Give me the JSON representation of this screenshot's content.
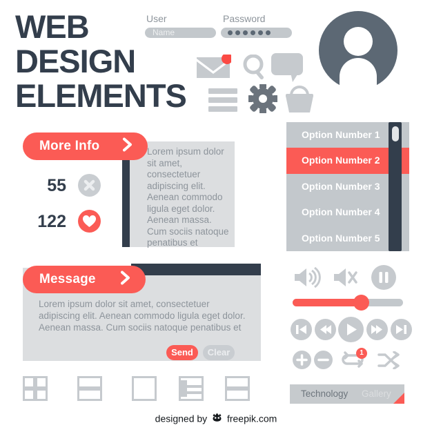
{
  "title": {
    "line1": "WEB",
    "line2": "DESIGN",
    "line3": "ELEMENTS"
  },
  "form": {
    "user_label": "User",
    "user_placeholder": "Name",
    "user_value": "",
    "password_label": "Password",
    "password_value": "••••••",
    "password_dot_count": 6
  },
  "icons": {
    "row1": [
      "envelope-icon",
      "search-icon",
      "chat-bubble-icon"
    ],
    "row2": [
      "hamburger-menu-icon",
      "gear-icon",
      "basket-icon"
    ],
    "avatar": "user-avatar-icon",
    "envelope_badge": true
  },
  "options": {
    "items": [
      {
        "label": "Option Number 1",
        "active": false
      },
      {
        "label": "Option Number 2",
        "active": true
      },
      {
        "label": "Option Number 3",
        "active": false
      },
      {
        "label": "Option Number 4",
        "active": false
      },
      {
        "label": "Option Number 5",
        "active": false
      }
    ]
  },
  "info_card": {
    "button_label": "More Info",
    "body_text": "Lorem ipsum dolor sit amet, consectetuer adipiscing elit. Aenean commodo ligula eget dolor. Aenean massa. Cum sociis natoque penatibus et",
    "counters": [
      {
        "value": "55",
        "icon": "close-icon",
        "color": "#c9cdd1"
      },
      {
        "value": "122",
        "icon": "heart-icon",
        "color": "#fb5b55"
      }
    ]
  },
  "message_card": {
    "button_label": "Message",
    "body_text": "Lorem ipsum dolor sit amet, consectetuer adipiscing elit. Aenean commodo ligula eget dolor. Aenean massa. Cum sociis natoque penatibus et",
    "send_label": "Send",
    "clear_label": "Clear"
  },
  "layout_icons": [
    "grid-four-layout-icon",
    "two-row-layout-icon",
    "single-block-layout-icon",
    "list-layout-icon",
    "split-layout-icon"
  ],
  "media": {
    "volume_on_icon": "volume-on-icon",
    "volume_mute_icon": "volume-mute-icon",
    "pause_icon": "pause-icon",
    "volume_percent": 62,
    "transport": [
      "skip-to-start-icon",
      "rewind-icon",
      "play-icon",
      "fast-forward-icon",
      "skip-to-end-icon"
    ],
    "extra": [
      "plus-icon",
      "minus-icon",
      "repeat-icon",
      "shuffle-icon"
    ],
    "repeat_badge": "1"
  },
  "tabs": {
    "items": [
      {
        "label": "Technology",
        "selected": true
      },
      {
        "label": "Gallery",
        "selected": false
      }
    ]
  },
  "footer": {
    "prefix": "designed by",
    "brand": "freepik.com"
  },
  "colors": {
    "accent_red": "#fb5b55",
    "dark_navy": "#333e4c",
    "mid_gray": "#c3c8cc",
    "light_gray": "#dcdee0",
    "text_gray": "#8d949b"
  }
}
